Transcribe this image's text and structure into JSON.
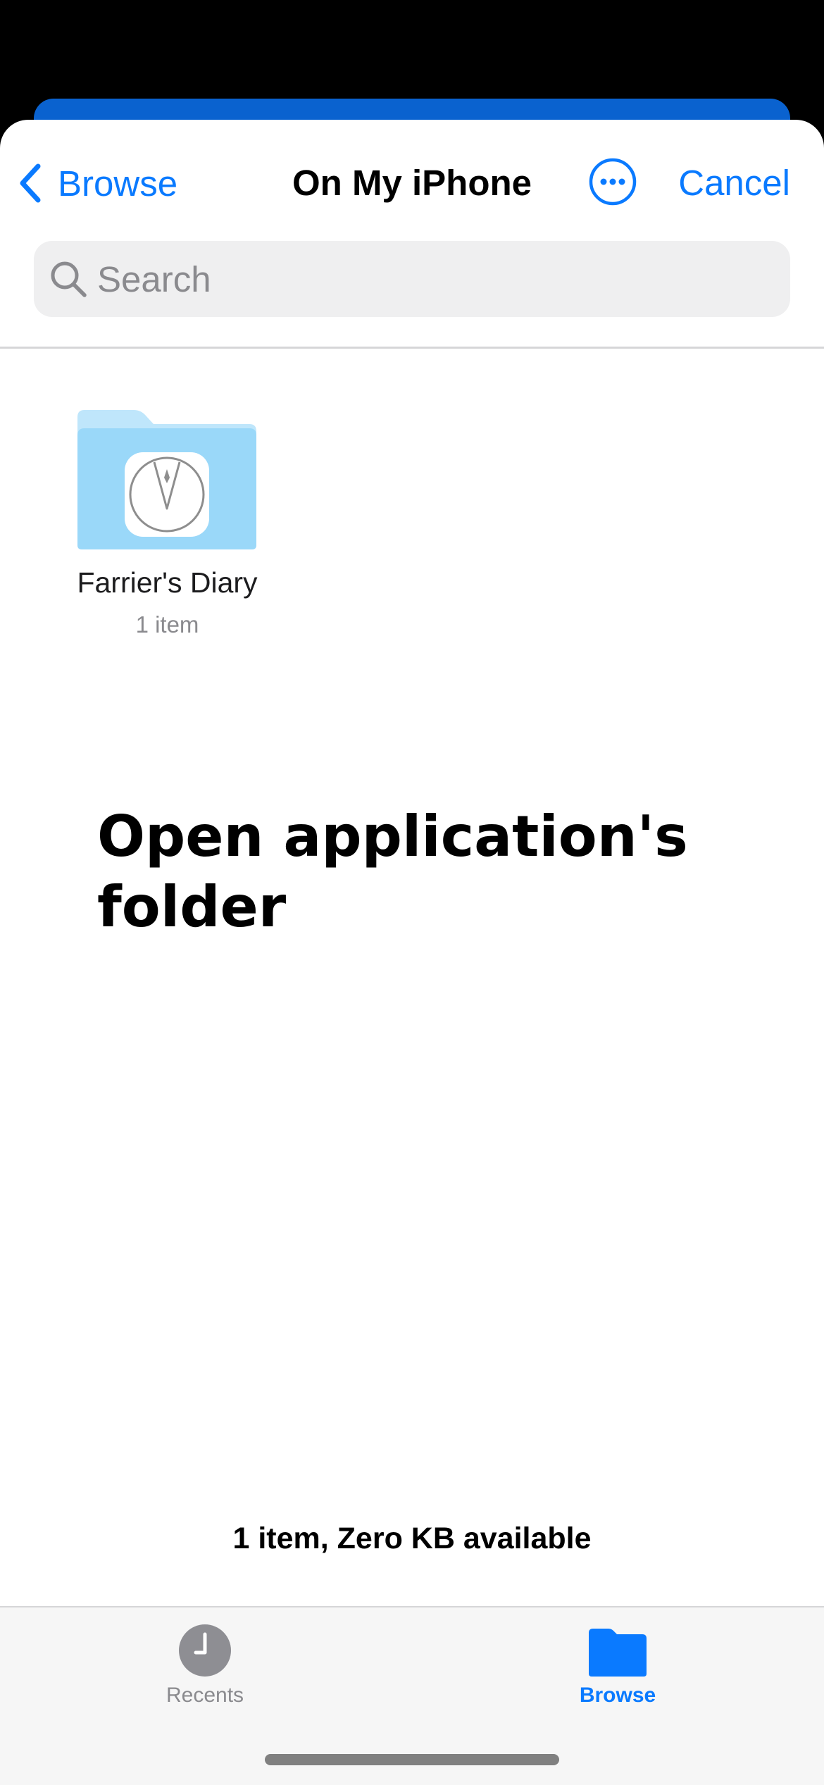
{
  "nav": {
    "back_label": "Browse",
    "title": "On My iPhone",
    "cancel_label": "Cancel"
  },
  "search": {
    "placeholder": "Search",
    "value": ""
  },
  "folder": {
    "name": "Farrier's Diary",
    "count": "1 item"
  },
  "overlay": {
    "caption": "Open application's folder"
  },
  "footer": {
    "storage": "1 item, Zero KB available"
  },
  "tabs": [
    {
      "label": "Recents",
      "icon": "clock-icon",
      "selected": false
    },
    {
      "label": "Browse",
      "icon": "folder-icon",
      "selected": true
    }
  ],
  "colors": {
    "accent": "#0A7AFF",
    "header_strip": "#0A62CF",
    "folder_front": "#9AD8F9",
    "folder_back": "#BFE6FB",
    "tab_inactive": "#8A8A8E"
  }
}
